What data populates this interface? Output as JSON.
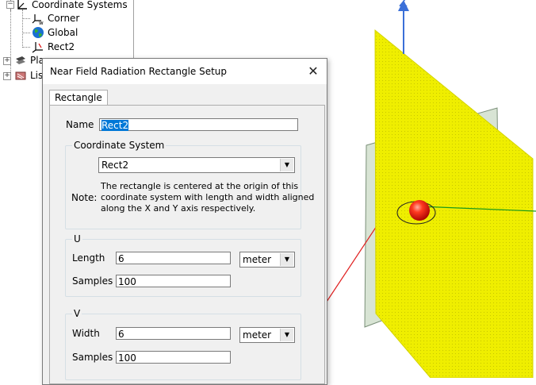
{
  "tree": {
    "root_label": "Coordinate Systems",
    "items": [
      {
        "label": "Corner",
        "icon": "axes-w-icon"
      },
      {
        "label": "Global",
        "icon": "globe-icon"
      },
      {
        "label": "Rect2",
        "icon": "axes-xyz-icon"
      }
    ],
    "planes_partial": "Pla",
    "lists_partial": "Lis"
  },
  "viewport": {
    "z_axis_label": "Z",
    "plane_color": "#f0ef00",
    "sphere_color": "#e81010"
  },
  "dialog": {
    "title": "Near Field Radiation Rectangle Setup",
    "close_glyph": "✕",
    "tab_label": "Rectangle",
    "name_label": "Name",
    "name_value": "Rect2",
    "coord_group_title": "Coordinate System",
    "coord_selected": "Rect2",
    "note_label": "Note:",
    "note_text": [
      "The rectangle is centered at the origin of this",
      "coordinate system with length and width aligned",
      "along the X and Y axis respectively."
    ],
    "u_group_title": "U",
    "length_label": "Length",
    "length_value": "6",
    "length_unit": "meter",
    "u_samples_label": "Samples",
    "u_samples_value": "100",
    "v_group_title": "V",
    "width_label": "Width",
    "width_value": "6",
    "width_unit": "meter",
    "v_samples_label": "Samples",
    "v_samples_value": "100"
  }
}
